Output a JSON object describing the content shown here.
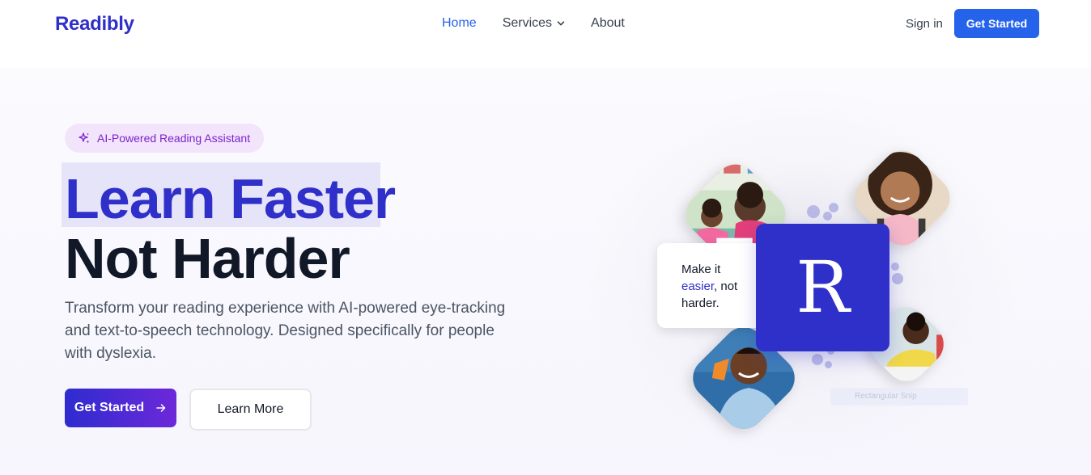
{
  "nav": {
    "logo": "Readibly",
    "links": [
      {
        "label": "Home",
        "active": true
      },
      {
        "label": "Services",
        "has_dropdown": true
      },
      {
        "label": "About"
      }
    ],
    "sign_in": "Sign in",
    "cta": "Get Started"
  },
  "hero": {
    "badge": "AI-Powered Reading Assistant",
    "headline_line1": "Learn Faster",
    "headline_line2": "Not Harder",
    "description": "Transform your reading experience with AI-powered eye-tracking and text-to-speech technology. Designed specifically for people with dyslexia.",
    "primary_button": "Get Started",
    "secondary_button": "Learn More"
  },
  "illustration": {
    "card_text_before": "Make it",
    "card_text_highlight": "easier",
    "card_text_after": ", not harder.",
    "logo_letter": "R",
    "faint_label": "Rectangular Snip"
  },
  "colors": {
    "brand": "#2f2fc9",
    "accent_blue": "#2563eb",
    "badge_bg": "#f1e4fb",
    "badge_text": "#7e22ce"
  }
}
